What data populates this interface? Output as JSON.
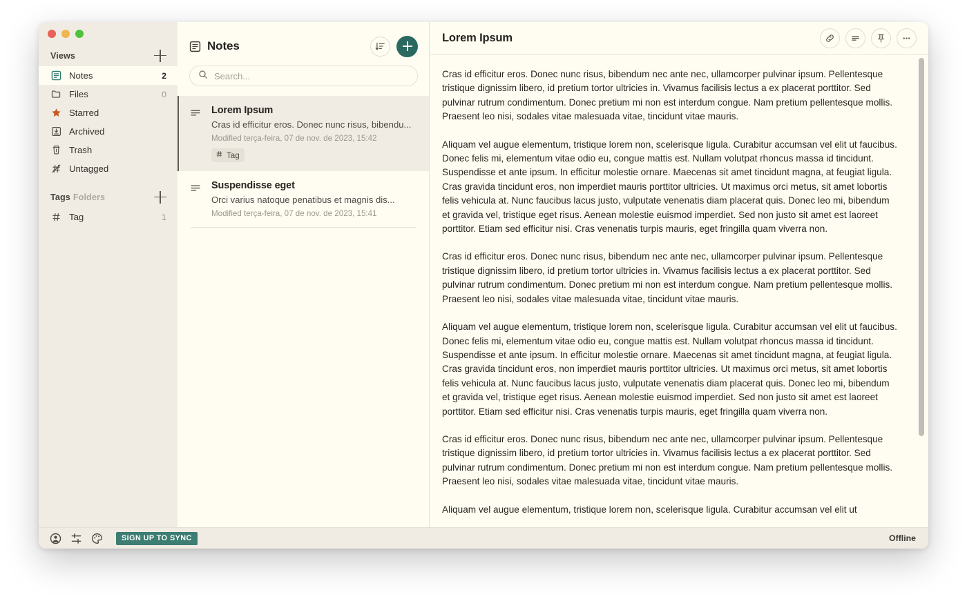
{
  "window": {
    "traffic_lights": [
      "close",
      "minimize",
      "zoom"
    ],
    "colors": {
      "close": "#e8615a",
      "minimize": "#edb64e",
      "zoom": "#4fc23c",
      "accent_teal": "#2b6960",
      "signup_teal": "#3d7d72",
      "sidebar_bg": "#f0ece4",
      "panel_bg": "#fffdf2",
      "star_orange": "#c85a22",
      "notes_icon_teal": "#2f7a6f"
    }
  },
  "sidebar": {
    "views": {
      "title": "Views",
      "add_label": "+",
      "items": [
        {
          "label": "Notes",
          "icon": "notes-icon",
          "count": "2",
          "active": true
        },
        {
          "label": "Files",
          "icon": "folder-icon",
          "count": "0",
          "active": false
        },
        {
          "label": "Starred",
          "icon": "star-icon",
          "count": "",
          "active": false
        },
        {
          "label": "Archived",
          "icon": "archive-icon",
          "count": "",
          "active": false
        },
        {
          "label": "Trash",
          "icon": "trash-icon",
          "count": "",
          "active": false
        },
        {
          "label": "Untagged",
          "icon": "untagged-icon",
          "count": "",
          "active": false
        }
      ]
    },
    "tags": {
      "title": "Tags",
      "alt_title": "Folders",
      "add_label": "+",
      "items": [
        {
          "label": "Tag",
          "icon": "hash-icon",
          "count": "1"
        }
      ]
    }
  },
  "notelist": {
    "title": "Notes",
    "title_icon": "notes-icon",
    "sort_icon": "sort-descending-icon",
    "add_icon": "plus-icon",
    "search": {
      "placeholder": "Search...",
      "value": "",
      "icon": "search-icon"
    },
    "notes": [
      {
        "title": "Lorem Ipsum",
        "preview": "Cras id efficitur eros. Donec nunc risus, bibendu...",
        "modified": "Modified terça-feira, 07 de nov. de 2023, 15:42",
        "tags": [
          "Tag"
        ],
        "selected": true
      },
      {
        "title": "Suspendisse eget",
        "preview": "Orci varius natoque penatibus et magnis dis...",
        "modified": "Modified terça-feira, 07 de nov. de 2023, 15:41",
        "tags": [],
        "selected": false
      }
    ]
  },
  "editor": {
    "title": "Lorem Ipsum",
    "actions": [
      {
        "name": "link-icon",
        "label": "Link"
      },
      {
        "name": "lines-icon",
        "label": "Format"
      },
      {
        "name": "pin-icon",
        "label": "Pin"
      },
      {
        "name": "ellipsis-icon",
        "label": "More options"
      }
    ],
    "paragraphs": [
      "Cras id efficitur eros. Donec nunc risus, bibendum nec ante nec, ullamcorper pulvinar ipsum. Pellentesque tristique dignissim libero, id pretium tortor ultricies in. Vivamus facilisis lectus a ex placerat porttitor. Sed pulvinar rutrum condimentum. Donec pretium mi non est interdum congue. Nam pretium pellentesque mollis. Praesent leo nisi, sodales vitae malesuada vitae, tincidunt vitae mauris.",
      "Aliquam vel augue elementum, tristique lorem non, scelerisque ligula. Curabitur accumsan vel elit ut faucibus. Donec felis mi, elementum vitae odio eu, congue mattis est. Nullam volutpat rhoncus massa id tincidunt. Suspendisse et ante ipsum. In efficitur molestie ornare. Maecenas sit amet tincidunt magna, at feugiat ligula. Cras gravida tincidunt eros, non imperdiet mauris porttitor ultricies. Ut maximus orci metus, sit amet lobortis felis vehicula at. Nunc faucibus lacus justo, vulputate venenatis diam placerat quis. Donec leo mi, bibendum et gravida vel, tristique eget risus. Aenean molestie euismod imperdiet. Sed non justo sit amet est laoreet porttitor. Etiam sed efficitur nisi. Cras venenatis turpis mauris, eget fringilla quam viverra non.",
      "Cras id efficitur eros. Donec nunc risus, bibendum nec ante nec, ullamcorper pulvinar ipsum. Pellentesque tristique dignissim libero, id pretium tortor ultricies in. Vivamus facilisis lectus a ex placerat porttitor. Sed pulvinar rutrum condimentum. Donec pretium mi non est interdum congue. Nam pretium pellentesque mollis. Praesent leo nisi, sodales vitae malesuada vitae, tincidunt vitae mauris.",
      "Aliquam vel augue elementum, tristique lorem non, scelerisque ligula. Curabitur accumsan vel elit ut faucibus. Donec felis mi, elementum vitae odio eu, congue mattis est. Nullam volutpat rhoncus massa id tincidunt. Suspendisse et ante ipsum. In efficitur molestie ornare. Maecenas sit amet tincidunt magna, at feugiat ligula. Cras gravida tincidunt eros, non imperdiet mauris porttitor ultricies. Ut maximus orci metus, sit amet lobortis felis vehicula at. Nunc faucibus lacus justo, vulputate venenatis diam placerat quis. Donec leo mi, bibendum et gravida vel, tristique eget risus. Aenean molestie euismod imperdiet. Sed non justo sit amet est laoreet porttitor. Etiam sed efficitur nisi. Cras venenatis turpis mauris, eget fringilla quam viverra non.",
      "Cras id efficitur eros. Donec nunc risus, bibendum nec ante nec, ullamcorper pulvinar ipsum. Pellentesque tristique dignissim libero, id pretium tortor ultricies in. Vivamus facilisis lectus a ex placerat porttitor. Sed pulvinar rutrum condimentum. Donec pretium mi non est interdum congue. Nam pretium pellentesque mollis. Praesent leo nisi, sodales vitae malesuada vitae, tincidunt vitae mauris.",
      "Aliquam vel augue elementum, tristique lorem non, scelerisque ligula. Curabitur accumsan vel elit ut"
    ]
  },
  "statusbar": {
    "account_icon": "account-icon",
    "preferences_icon": "sliders-icon",
    "theme_icon": "palette-icon",
    "signup_label": "SIGN UP TO SYNC",
    "connection_status": "Offline"
  }
}
